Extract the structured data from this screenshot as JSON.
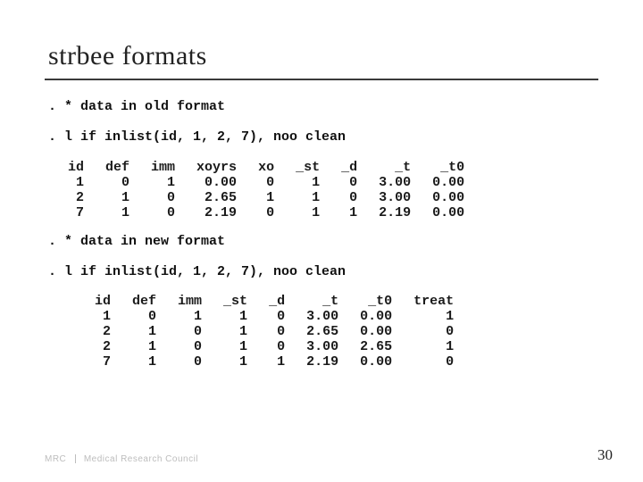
{
  "title": "strbee formats",
  "lines": {
    "comment_old": ". * data in old format",
    "cmd_old": ". l if inlist(id, 1, 2, 7), noo clean",
    "comment_new": ". * data in new format",
    "cmd_new": ". l if inlist(id, 1, 2, 7), noo clean"
  },
  "table_old": {
    "headers": [
      "id",
      "def",
      "imm",
      "xoyrs",
      "xo",
      "_st",
      "_d",
      "_t",
      "_t0"
    ],
    "rows": [
      [
        "1",
        "0",
        "1",
        "0.00",
        "0",
        "1",
        "0",
        "3.00",
        "0.00"
      ],
      [
        "2",
        "1",
        "0",
        "2.65",
        "1",
        "1",
        "0",
        "3.00",
        "0.00"
      ],
      [
        "7",
        "1",
        "0",
        "2.19",
        "0",
        "1",
        "1",
        "2.19",
        "0.00"
      ]
    ]
  },
  "table_new": {
    "headers": [
      "id",
      "def",
      "imm",
      "_st",
      "_d",
      "_t",
      "_t0",
      "treat"
    ],
    "rows": [
      [
        "1",
        "0",
        "1",
        "1",
        "0",
        "3.00",
        "0.00",
        "1"
      ],
      [
        "2",
        "1",
        "0",
        "1",
        "0",
        "2.65",
        "0.00",
        "0"
      ],
      [
        "2",
        "1",
        "0",
        "1",
        "0",
        "3.00",
        "2.65",
        "1"
      ],
      [
        "7",
        "1",
        "0",
        "1",
        "1",
        "2.19",
        "0.00",
        "0"
      ]
    ]
  },
  "footer": {
    "logo_left": "MRC",
    "logo_right": "Medical Research Council"
  },
  "page_number": "30"
}
